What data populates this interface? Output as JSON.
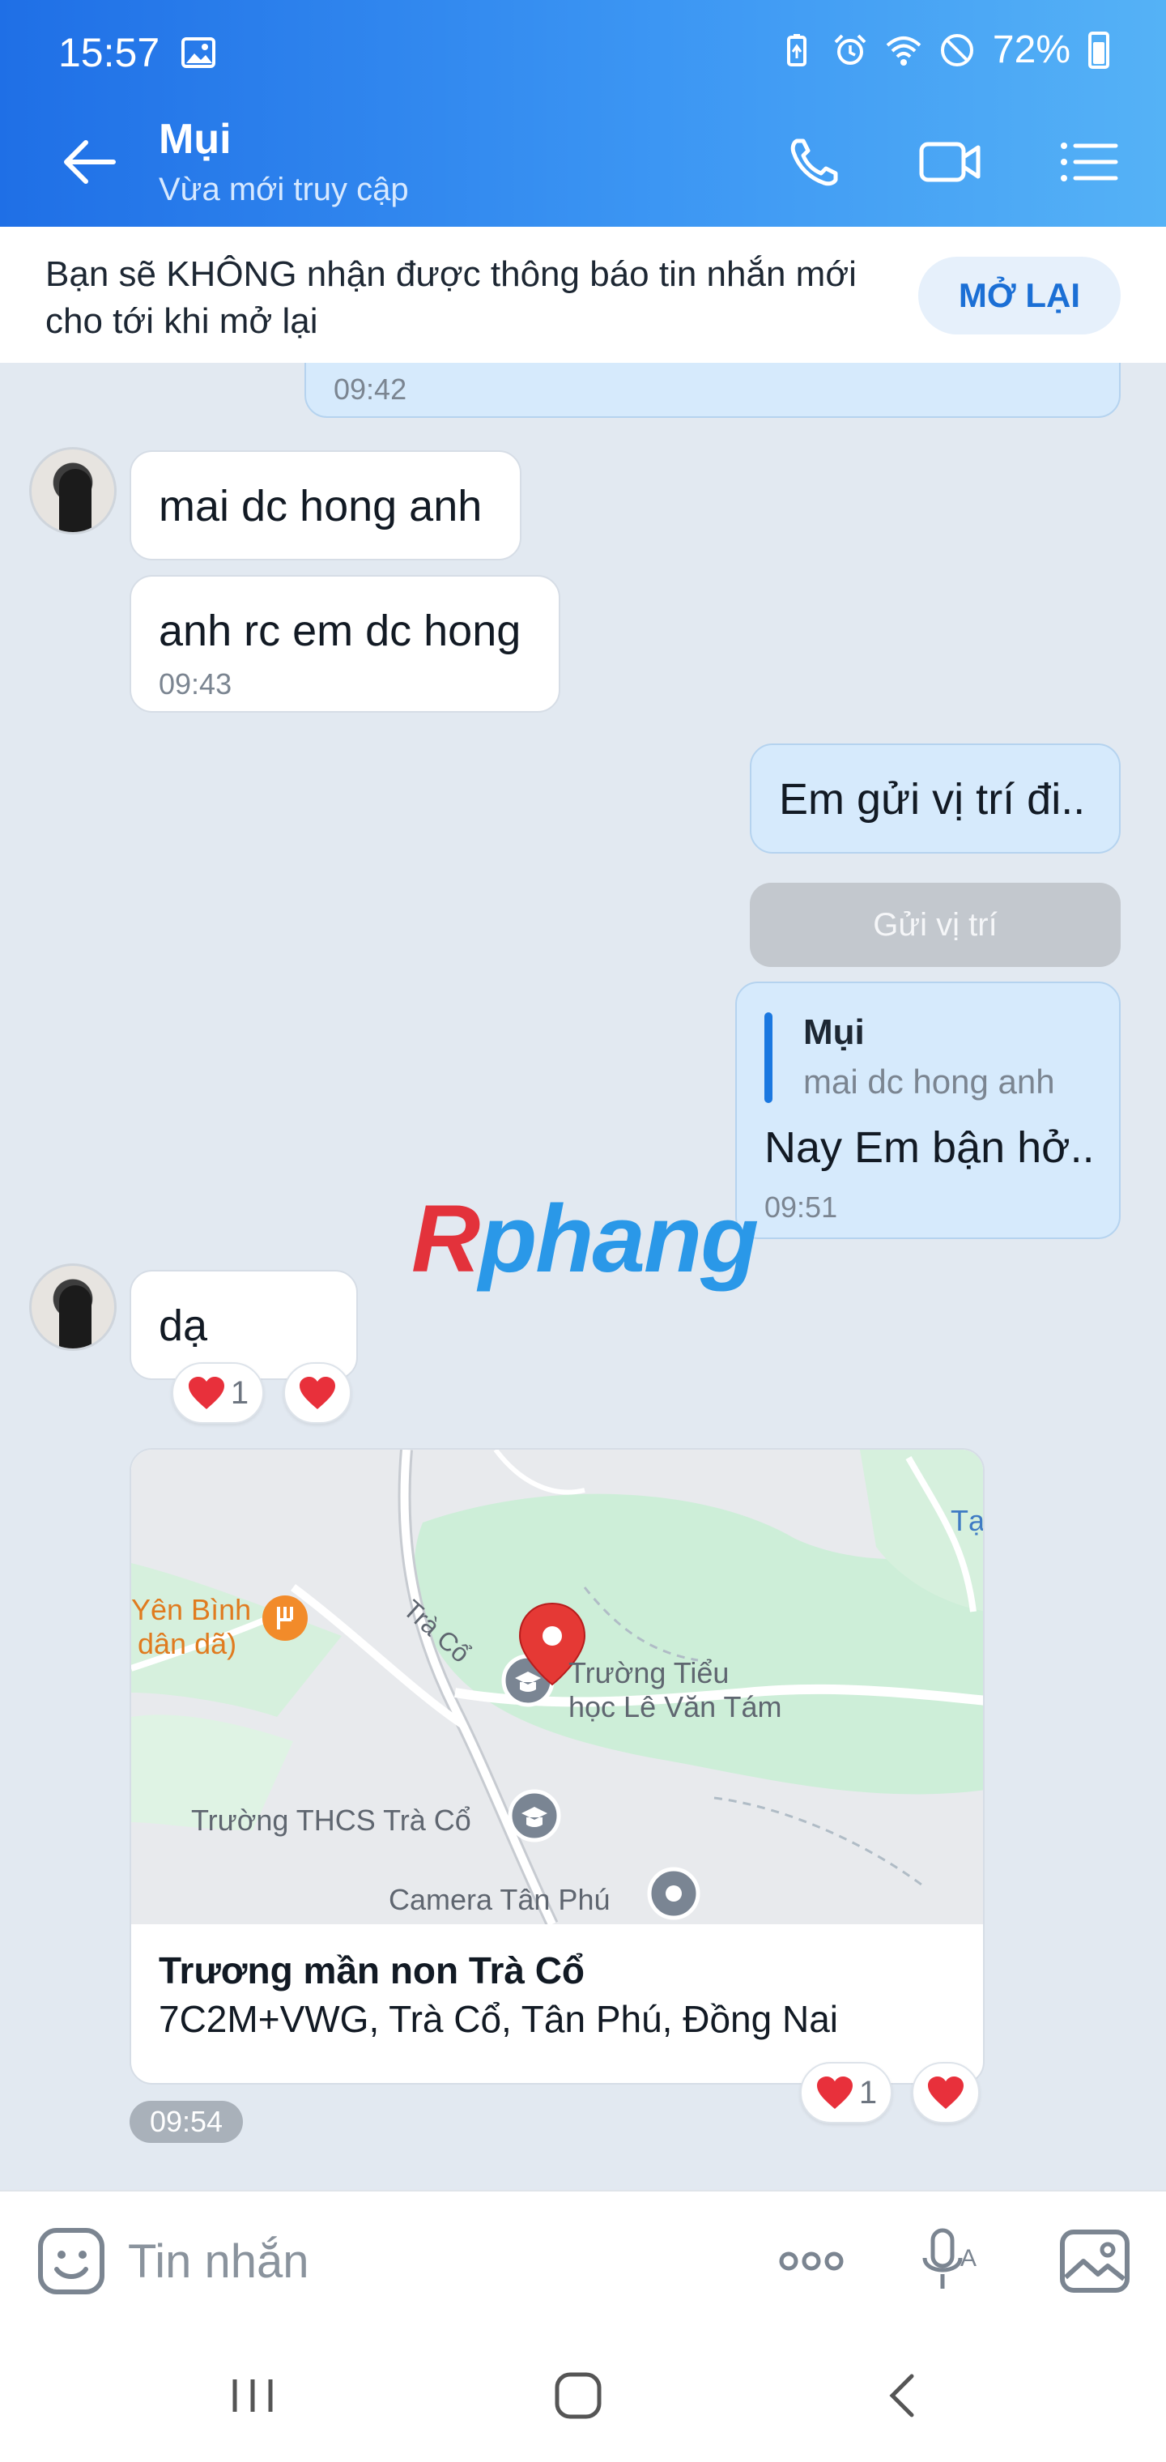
{
  "status_bar": {
    "time": "15:57",
    "battery_pct": "72%"
  },
  "header": {
    "contact_name": "Mụi",
    "contact_status": "Vừa mới truy cập"
  },
  "notice": {
    "text": "Bạn sẽ KHÔNG nhận được thông báo tin nhắn mới cho tới khi mở lại",
    "button": "MỞ LẠI"
  },
  "messages": [
    {
      "dir": "out",
      "time": "09:42"
    },
    {
      "dir": "in",
      "text": "mai dc hong anh"
    },
    {
      "dir": "in",
      "text": "anh rc em dc hong",
      "time": "09:43"
    },
    {
      "dir": "out",
      "text": "Em gửi vị trí đi.."
    },
    {
      "dir": "out",
      "action": "Gửi vị trí"
    },
    {
      "dir": "out",
      "quote_name": "Mụi",
      "quote_text": "mai dc hong anh",
      "text": "Nay Em bận hở..",
      "time": "09:51"
    },
    {
      "dir": "in",
      "text": "dạ",
      "reaction_count": "1"
    },
    {
      "dir": "in",
      "type": "location",
      "title": "Trương mần non Trà Cổ",
      "address": "7C2M+VWG, Trà Cổ, Tân Phú, Đồng Nai",
      "reaction_count": "1",
      "time": "09:54"
    }
  ],
  "map_labels": {
    "place1": "Trường Tiểu",
    "place1b": "học Lê Văn Tám",
    "place2": "Trường THCS Trà Cổ",
    "place3": "Camera Tân Phú",
    "place4": "Yên Bình",
    "place4b": "dân dã)",
    "road": "Trà Cổ",
    "edge": "Tạ"
  },
  "watermark": {
    "r": "R",
    "rest": "phang"
  },
  "input": {
    "placeholder": "Tin nhắn"
  },
  "colors": {
    "header_start": "#1f6fe6",
    "header_end": "#55b2f6",
    "chat_bg": "#e2e9f1",
    "bubble_out": "#d6eafc",
    "accent": "#1b6fd5"
  }
}
